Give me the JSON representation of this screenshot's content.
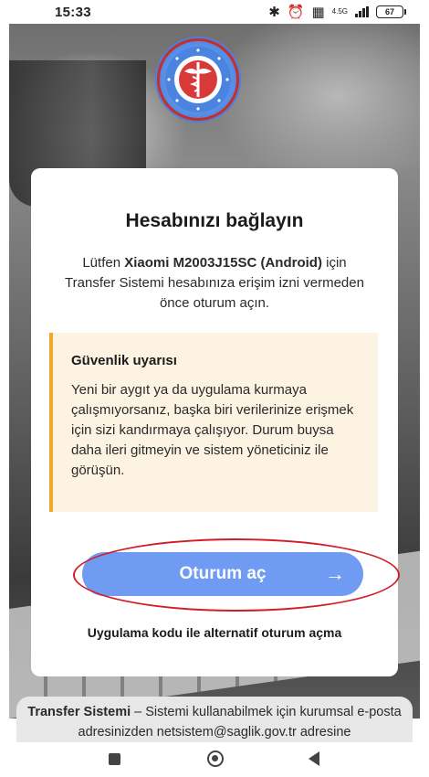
{
  "status_bar": {
    "time": "15:33",
    "network_type": "4.5G",
    "battery": "67"
  },
  "card": {
    "title": "Hesabınızı bağlayın",
    "desc_prefix": "Lütfen ",
    "device_name": "Xiaomi M2003J15SC (Android)",
    "desc_suffix": " için Transfer Sistemi hesabınıza erişim izni vermeden önce oturum açın.",
    "warning_title": "Güvenlik uyarısı",
    "warning_text": "Yeni bir aygıt ya da uygulama kurmaya çalışmıyorsanız, başka biri verilerinize erişmek için sizi kandırmaya çalışıyor. Durum buysa daha ileri gitmeyin ve sistem yöneticiniz ile görüşün.",
    "signin_label": "Oturum aç",
    "signin_arrow": "→",
    "alt_link": "Uygulama kodu ile alternatif oturum açma"
  },
  "footer": {
    "app_name": "Transfer Sistemi",
    "text": " – Sistemi kullanabilmek için kurumsal e-posta adresinizden netsistem@saglik.gov.tr adresine"
  },
  "colors": {
    "accent_button": "#6f9cf2",
    "warning_border": "#f0a929",
    "warning_bg": "#fdf3e3",
    "highlight_ring": "#d21e2a"
  }
}
